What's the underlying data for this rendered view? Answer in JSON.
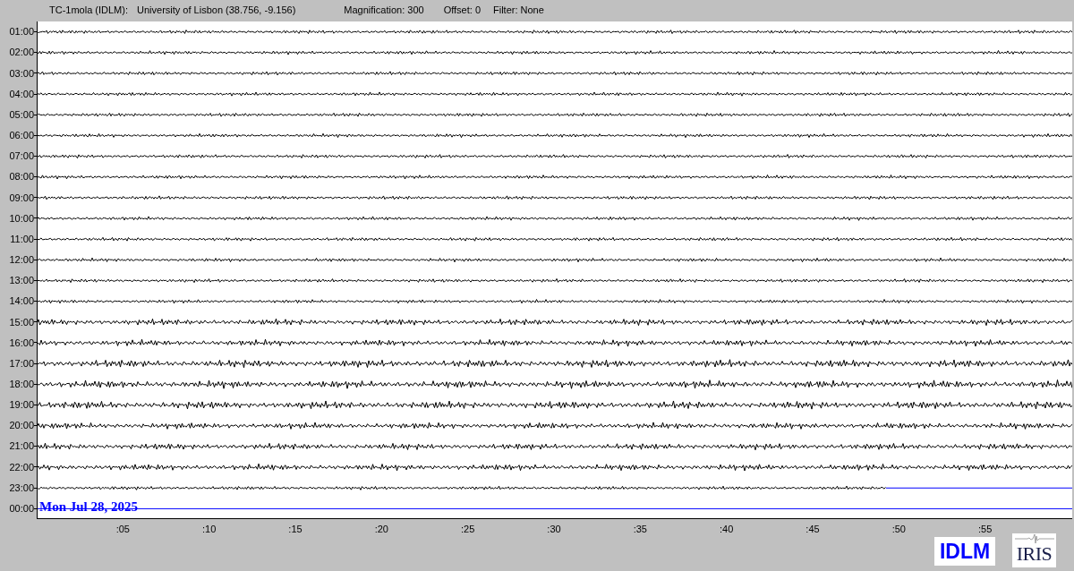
{
  "header": {
    "station": "TC-1mola (IDLM):",
    "location": "University of Lisbon (38.756, -9.156)",
    "magnification": "Magnification: 300",
    "offset": "Offset: 0",
    "filter": "Filter: None"
  },
  "rows": [
    {
      "label": "01:00",
      "kind": "full"
    },
    {
      "label": "02:00",
      "kind": "full"
    },
    {
      "label": "03:00",
      "kind": "full"
    },
    {
      "label": "04:00",
      "kind": "full"
    },
    {
      "label": "05:00",
      "kind": "full"
    },
    {
      "label": "06:00",
      "kind": "full"
    },
    {
      "label": "07:00",
      "kind": "full"
    },
    {
      "label": "08:00",
      "kind": "full"
    },
    {
      "label": "09:00",
      "kind": "full"
    },
    {
      "label": "10:00",
      "kind": "full"
    },
    {
      "label": "11:00",
      "kind": "full"
    },
    {
      "label": "12:00",
      "kind": "full"
    },
    {
      "label": "13:00",
      "kind": "full"
    },
    {
      "label": "14:00",
      "kind": "full"
    },
    {
      "label": "15:00",
      "kind": "full"
    },
    {
      "label": "16:00",
      "kind": "full"
    },
    {
      "label": "17:00",
      "kind": "full"
    },
    {
      "label": "18:00",
      "kind": "full"
    },
    {
      "label": "19:00",
      "kind": "full"
    },
    {
      "label": "20:00",
      "kind": "full"
    },
    {
      "label": "21:00",
      "kind": "full"
    },
    {
      "label": "22:00",
      "kind": "full"
    },
    {
      "label": "23:00",
      "kind": "partial"
    },
    {
      "label": "00:00",
      "kind": "empty"
    }
  ],
  "date": "Mon Jul 28, 2025",
  "x_ticks": [
    ":05",
    ":10",
    ":15",
    ":20",
    ":25",
    ":30",
    ":35",
    ":40",
    ":45",
    ":50",
    ":55"
  ],
  "logo_text": "IDLM",
  "iris_text": "IRIS"
}
